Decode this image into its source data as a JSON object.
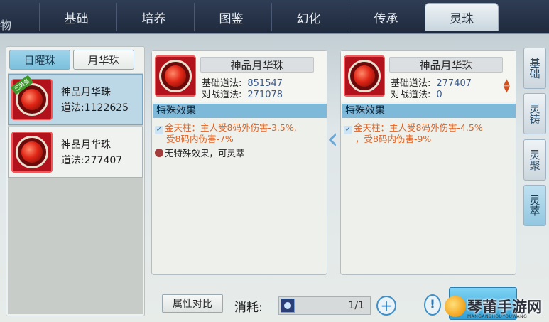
{
  "top_tabs": {
    "corner_glyph": "物",
    "items": [
      "基础",
      "培养",
      "图鉴",
      "幻化",
      "传承",
      "灵珠"
    ],
    "active": "灵珠"
  },
  "left_panel": {
    "subtabs": [
      "日曜珠",
      "月华珠"
    ],
    "active_subtab": "日曜珠",
    "items": [
      {
        "name": "神品月华珠",
        "value": "道法:1122625",
        "badge": "已装备",
        "selected": true
      },
      {
        "name": "神品月华珠",
        "value": "道法:277407",
        "selected": false
      }
    ]
  },
  "compare_left": {
    "title": "神品月华珠",
    "stat_base_label": "基础道法:",
    "stat_base_value": "851547",
    "stat_battle_label": "对战道法:",
    "stat_battle_value": "271078",
    "section_title": "特殊效果",
    "effect_line1": "金天柱：主人受8码外伤害-3.5%,",
    "effect_line2": "受8码内伤害-7%",
    "neutral_effect": "无特殊效果，可灵萃"
  },
  "compare_right": {
    "title": "神品月华珠",
    "stat_base_label": "基础道法:",
    "stat_base_value": "277407",
    "stat_battle_label": "对战道法:",
    "stat_battle_value": "0",
    "section_title": "特殊效果",
    "effect_line1": "金天柱：主人受8码外伤害-4.5%",
    "effect_line2": "，受8码内伤害-9%"
  },
  "side_buttons": [
    "基础",
    "灵铸",
    "灵聚",
    "灵萃"
  ],
  "active_side_button": "灵萃",
  "bottom": {
    "attr_compare_label": "属性对比",
    "cost_label": "消耗:",
    "cost_quantity": "1/1",
    "plus_glyph": "+",
    "info_glyph": "!"
  },
  "watermark": {
    "text": "琴莆手游网",
    "sub": "MANGANSHOUYOUWANG"
  },
  "colors": {
    "tab_bar": "#2f3d55",
    "accent_blue": "#7fb9da",
    "effect_orange": "#e06220",
    "orb_red": "#e02616"
  }
}
